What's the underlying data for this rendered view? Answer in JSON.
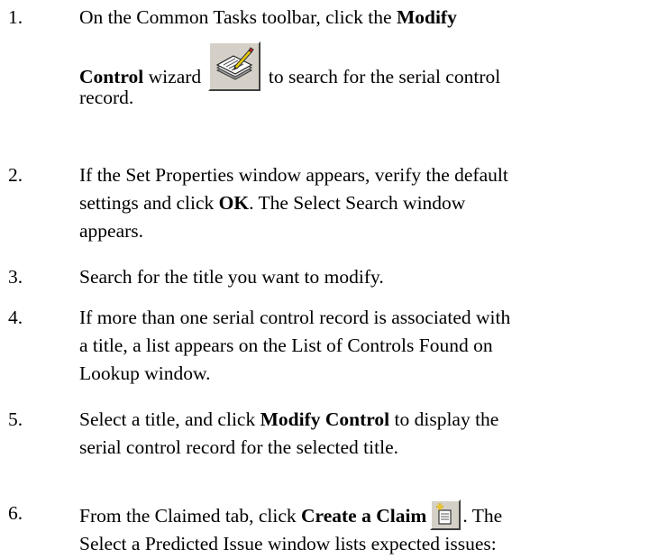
{
  "steps": [
    {
      "number": "1.",
      "line1_pre": "On the Common Tasks toolbar, click the ",
      "line1_bold": "Modify",
      "line2_bold": "Control",
      "line2_mid": " wizard ",
      "icon": "modify-control-wizard-icon",
      "line2_post": " to search for the serial control",
      "line3": "record."
    },
    {
      "number": "2.",
      "line1": "If the Set Properties window appears, verify the default",
      "line2_pre": "settings and click ",
      "line2_bold": "OK",
      "line2_post": ". The Select Search window",
      "line3": "appears."
    },
    {
      "number": "3.",
      "line1": "Search for the title you want to modify."
    },
    {
      "number": "4.",
      "line1": "If more than one serial control record is associated with",
      "line2": "a title, a list appears on the List of Controls Found on",
      "line3": "Lookup window."
    },
    {
      "number": "5.",
      "line1_pre": "Select a title, and click ",
      "line1_bold": "Modify Control",
      "line1_post": " to display the",
      "line2": "serial control record for the selected title."
    },
    {
      "number": "6.",
      "line1_pre": "From the Claimed tab, click ",
      "line1_bold": "Create a Claim",
      "icon": "create-claim-icon",
      "line1_post": ". The",
      "line2": "Select a Predicted Issue window lists expected issues:"
    }
  ]
}
